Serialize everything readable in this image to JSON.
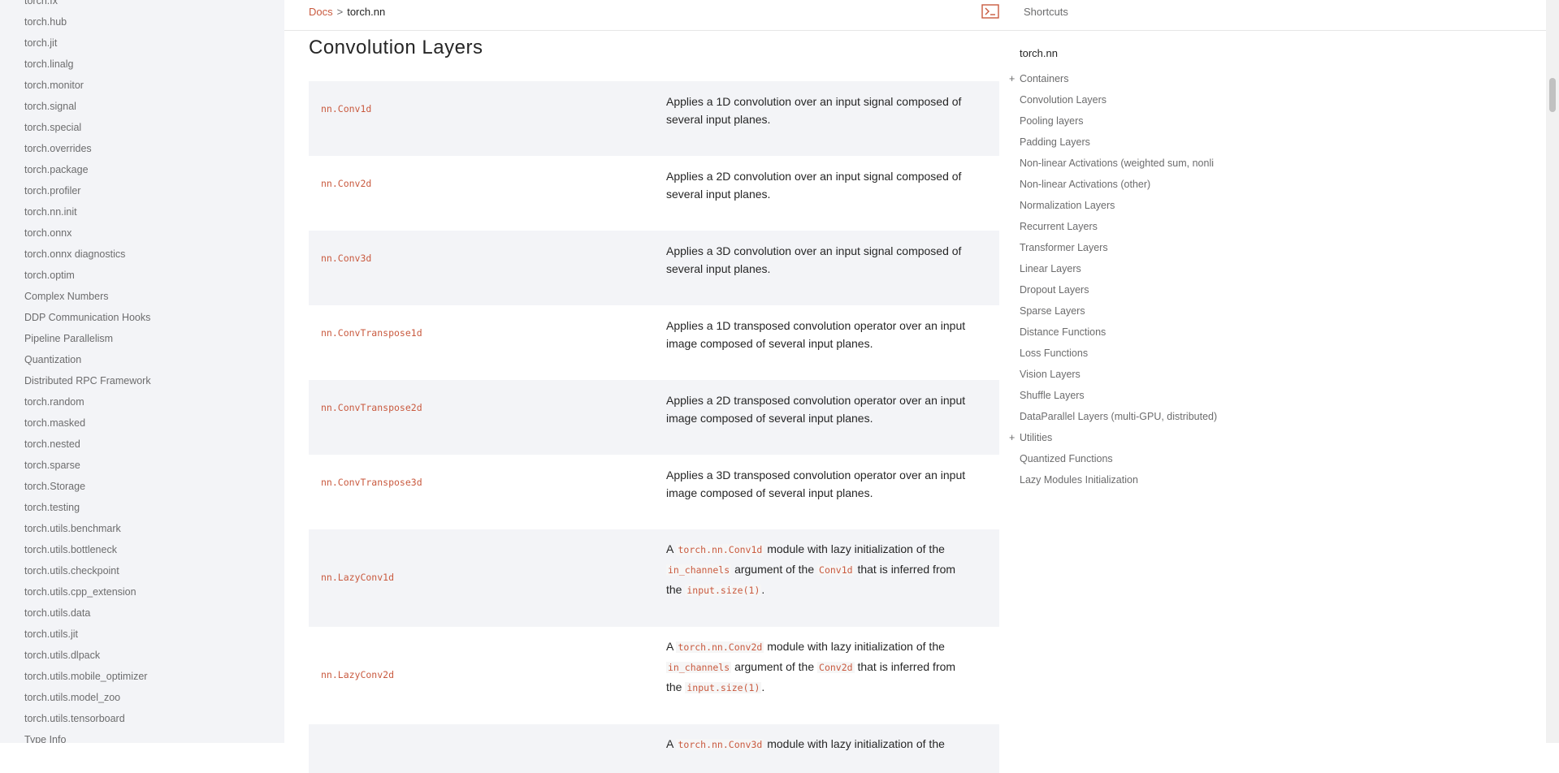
{
  "sidebar": {
    "items": [
      "torch.fx",
      "torch.hub",
      "torch.jit",
      "torch.linalg",
      "torch.monitor",
      "torch.signal",
      "torch.special",
      "torch.overrides",
      "torch.package",
      "torch.profiler",
      "torch.nn.init",
      "torch.onnx",
      "torch.onnx diagnostics",
      "torch.optim",
      "Complex Numbers",
      "DDP Communication Hooks",
      "Pipeline Parallelism",
      "Quantization",
      "Distributed RPC Framework",
      "torch.random",
      "torch.masked",
      "torch.nested",
      "torch.sparse",
      "torch.Storage",
      "torch.testing",
      "torch.utils.benchmark",
      "torch.utils.bottleneck",
      "torch.utils.checkpoint",
      "torch.utils.cpp_extension",
      "torch.utils.data",
      "torch.utils.jit",
      "torch.utils.dlpack",
      "torch.utils.mobile_optimizer",
      "torch.utils.model_zoo",
      "torch.utils.tensorboard",
      "Type Info"
    ]
  },
  "header": {
    "breadcrumb_link": "Docs",
    "breadcrumb_sep": ">",
    "breadcrumb_current": "torch.nn",
    "terminal_icon": "terminal-icon",
    "shortcuts_label": "Shortcuts"
  },
  "main": {
    "title": "Convolution Layers",
    "rows": [
      {
        "name": "nn.Conv1d",
        "line1": "Applies a 1D convolution over an input signal composed of",
        "line2": "several input planes."
      },
      {
        "name": "nn.Conv2d",
        "line1": "Applies a 2D convolution over an input signal composed of",
        "line2": "several input planes."
      },
      {
        "name": "nn.Conv3d",
        "line1": "Applies a 3D convolution over an input signal composed of",
        "line2": "several input planes."
      },
      {
        "name": "nn.ConvTranspose1d",
        "line1": "Applies a 1D transposed convolution operator over an input",
        "line2": "image composed of several input planes."
      },
      {
        "name": "nn.ConvTranspose2d",
        "line1": "Applies a 2D transposed convolution operator over an input",
        "line2": "image composed of several input planes."
      },
      {
        "name": "nn.ConvTranspose3d",
        "line1": "Applies a 3D transposed convolution operator over an input",
        "line2": "image composed of several input planes."
      }
    ],
    "lazy_rows": [
      {
        "name": "nn.LazyConv1d",
        "a": "A",
        "module_code": "torch.nn.Conv1d",
        "t1": "module with lazy initialization of the",
        "in_channels": "in_channels",
        "t2": "argument of the",
        "cls_code": "Conv1d",
        "t3": "that is inferred from",
        "the": "the",
        "size_code": "input.size(1)",
        "period": "."
      },
      {
        "name": "nn.LazyConv2d",
        "a": "A",
        "module_code": "torch.nn.Conv2d",
        "t1": "module with lazy initialization of the",
        "in_channels": "in_channels",
        "t2": "argument of the",
        "cls_code": "Conv2d",
        "t3": "that is inferred from",
        "the": "the",
        "size_code": "input.size(1)",
        "period": "."
      }
    ],
    "partial_row": {
      "a": "A",
      "module_code": "torch.nn.Conv3d",
      "t1": "module with lazy initialization of the"
    }
  },
  "toc": {
    "title": "torch.nn",
    "items": [
      {
        "label": "Containers",
        "expandable": true
      },
      {
        "label": "Convolution Layers",
        "expandable": false
      },
      {
        "label": "Pooling layers",
        "expandable": false
      },
      {
        "label": "Padding Layers",
        "expandable": false
      },
      {
        "label": "Non-linear Activations (weighted sum, nonli",
        "expandable": false
      },
      {
        "label": "Non-linear Activations (other)",
        "expandable": false
      },
      {
        "label": "Normalization Layers",
        "expandable": false
      },
      {
        "label": "Recurrent Layers",
        "expandable": false
      },
      {
        "label": "Transformer Layers",
        "expandable": false
      },
      {
        "label": "Linear Layers",
        "expandable": false
      },
      {
        "label": "Dropout Layers",
        "expandable": false
      },
      {
        "label": "Sparse Layers",
        "expandable": false
      },
      {
        "label": "Distance Functions",
        "expandable": false
      },
      {
        "label": "Loss Functions",
        "expandable": false
      },
      {
        "label": "Vision Layers",
        "expandable": false
      },
      {
        "label": "Shuffle Layers",
        "expandable": false
      },
      {
        "label": "DataParallel Layers (multi-GPU, distributed)",
        "expandable": false
      },
      {
        "label": "Utilities",
        "expandable": true
      },
      {
        "label": "Quantized Functions",
        "expandable": false
      },
      {
        "label": "Lazy Modules Initialization",
        "expandable": false
      }
    ],
    "expand_glyph": "+"
  },
  "colors": {
    "accent": "#c95a3f",
    "sidebar_bg": "#f3f4f7",
    "row_shade": "#f3f4f7",
    "muted_text": "#6c6c6d"
  }
}
